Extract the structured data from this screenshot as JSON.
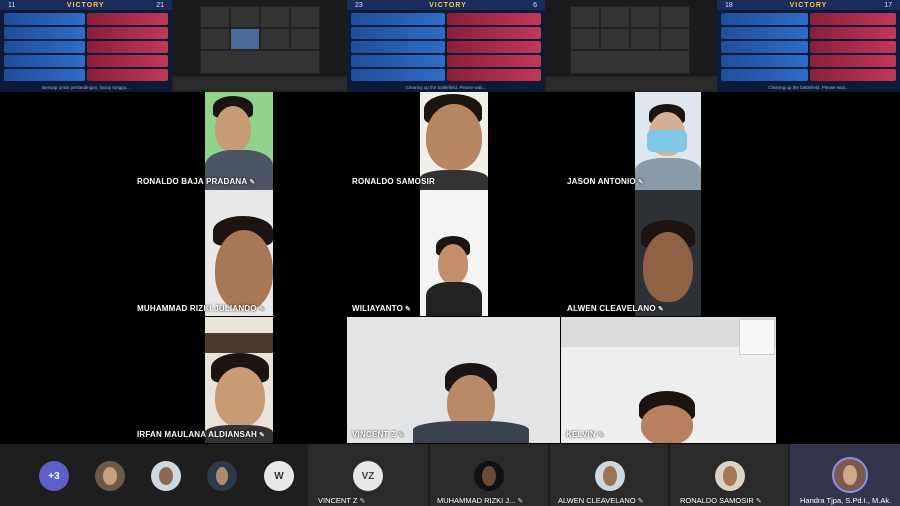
{
  "game_screens": [
    {
      "score_left": "11",
      "result": "VICTORY",
      "score_right": "21",
      "caption": "Bersiap untuk pertandingan, harap tunggu..."
    },
    {
      "score_left": "23",
      "result": "VICTORY",
      "score_right": "6",
      "caption": "Clearing up the battlefield. Please wait..."
    },
    {
      "score_left": "18",
      "result": "VICTORY",
      "score_right": "17",
      "caption": "Clearing up the battlefield. Please wait..."
    }
  ],
  "participants": {
    "ronaldo_baja": "RONALDO BAJA PRADANA",
    "ronaldo_samosir": "RONALDO SAMOSIR",
    "jason": "JASON ANTONIO",
    "rizki": "MUHAMMAD RIZKI JULIANDO",
    "wiliayanto": "WILIAYANTO",
    "alwen": "ALWEN CLEAVELANO",
    "irfan": "IRFAN MAULANA ALDIANSAH",
    "vincent": "VINCENT Z",
    "kelvin": "KELVIN"
  },
  "strip": {
    "more_count": "+3",
    "w_initial": "W",
    "vz_initial": "VZ",
    "tiles": [
      {
        "name": "VINCENT Z"
      },
      {
        "name": "MUHAMMAD RIZKI J..."
      },
      {
        "name": "ALWEN CLEAVELANO"
      },
      {
        "name": "RONALDO SAMOSIR"
      },
      {
        "name": "Handra Tjpa, S.Pd.I., M.Ak."
      }
    ]
  },
  "colors": {
    "more_bg": "#5b5fc7",
    "accent_ring": "#6264a7"
  },
  "icons": {
    "mic_off": "mic-off-icon"
  }
}
